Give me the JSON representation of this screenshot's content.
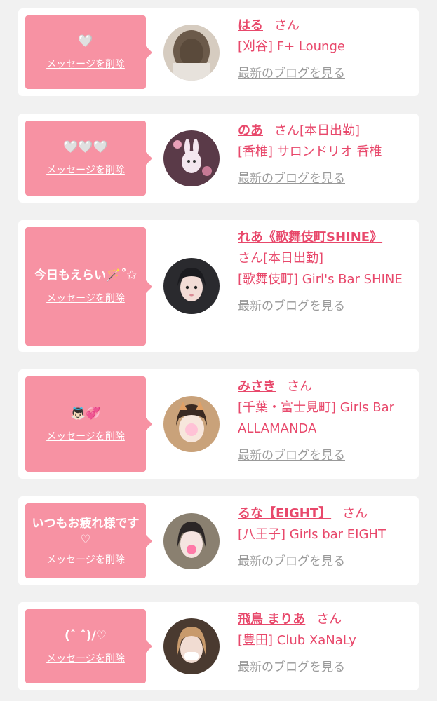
{
  "cards": [
    {
      "message": "🤍",
      "delete_label": "メッセージを削除",
      "name": "はる",
      "honorific": "さん",
      "status": "",
      "shop": "[刈谷] F+ Lounge",
      "blog_link": "最新のブログを見る"
    },
    {
      "message": "🤍🤍🤍",
      "delete_label": "メッセージを削除",
      "name": "のあ",
      "honorific": "さん",
      "status": "[本日出勤]",
      "shop": "[香椎] サロンドリオ 香椎",
      "blog_link": "最新のブログを見る"
    },
    {
      "message": "今日もえらい🪄˚✩",
      "delete_label": "メッセージを削除",
      "name": "れあ《歌舞伎町SHINE》",
      "honorific": "さん",
      "status": "[本日出勤]",
      "shop": "[歌舞伎町] Girl's Bar SHINE",
      "blog_link": "最新のブログを見る"
    },
    {
      "message": "👼🏻💞",
      "delete_label": "メッセージを削除",
      "name": "みさき",
      "honorific": "さん",
      "status": "",
      "shop": "[千葉・富士見町] Girls Bar ALLAMANDA",
      "blog_link": "最新のブログを見る"
    },
    {
      "message": "いつもお疲れ様です♡",
      "delete_label": "メッセージを削除",
      "name": "るな【EIGHT】",
      "honorific": "さん",
      "status": "",
      "shop": "[八王子] Girls bar EIGHT",
      "blog_link": "最新のブログを見る"
    },
    {
      "message": "(ˆ ˆ)/♡",
      "delete_label": "メッセージを削除",
      "name": "飛鳥 まりあ",
      "honorific": "さん",
      "status": "",
      "shop": "[豊田] Club XaNaLy",
      "blog_link": "最新のブログを見る"
    }
  ]
}
